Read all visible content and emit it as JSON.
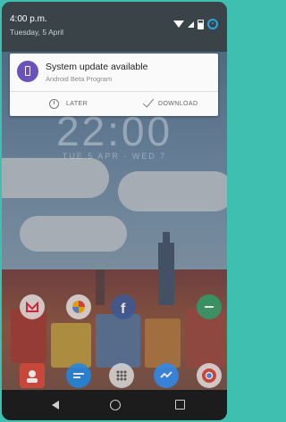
{
  "status_bar": {
    "time": "4:00 p.m.",
    "date": "Tuesday, 5 April"
  },
  "notification": {
    "title": "System update available",
    "subtitle": "Android Beta Program",
    "actions": {
      "later": "LATER",
      "download": "DOWNLOAD"
    },
    "accent_color": "#6a53b8"
  },
  "home_screen": {
    "apps": [
      "gmail-icon",
      "photos-icon",
      "facebook-icon",
      "messaging-icon",
      "contacts-icon",
      "hangouts-icon",
      "chrome-icon",
      "app-drawer-icon",
      "messenger-icon"
    ]
  },
  "nav": {
    "icons": [
      "back-icon",
      "home-icon",
      "recents-icon"
    ]
  }
}
